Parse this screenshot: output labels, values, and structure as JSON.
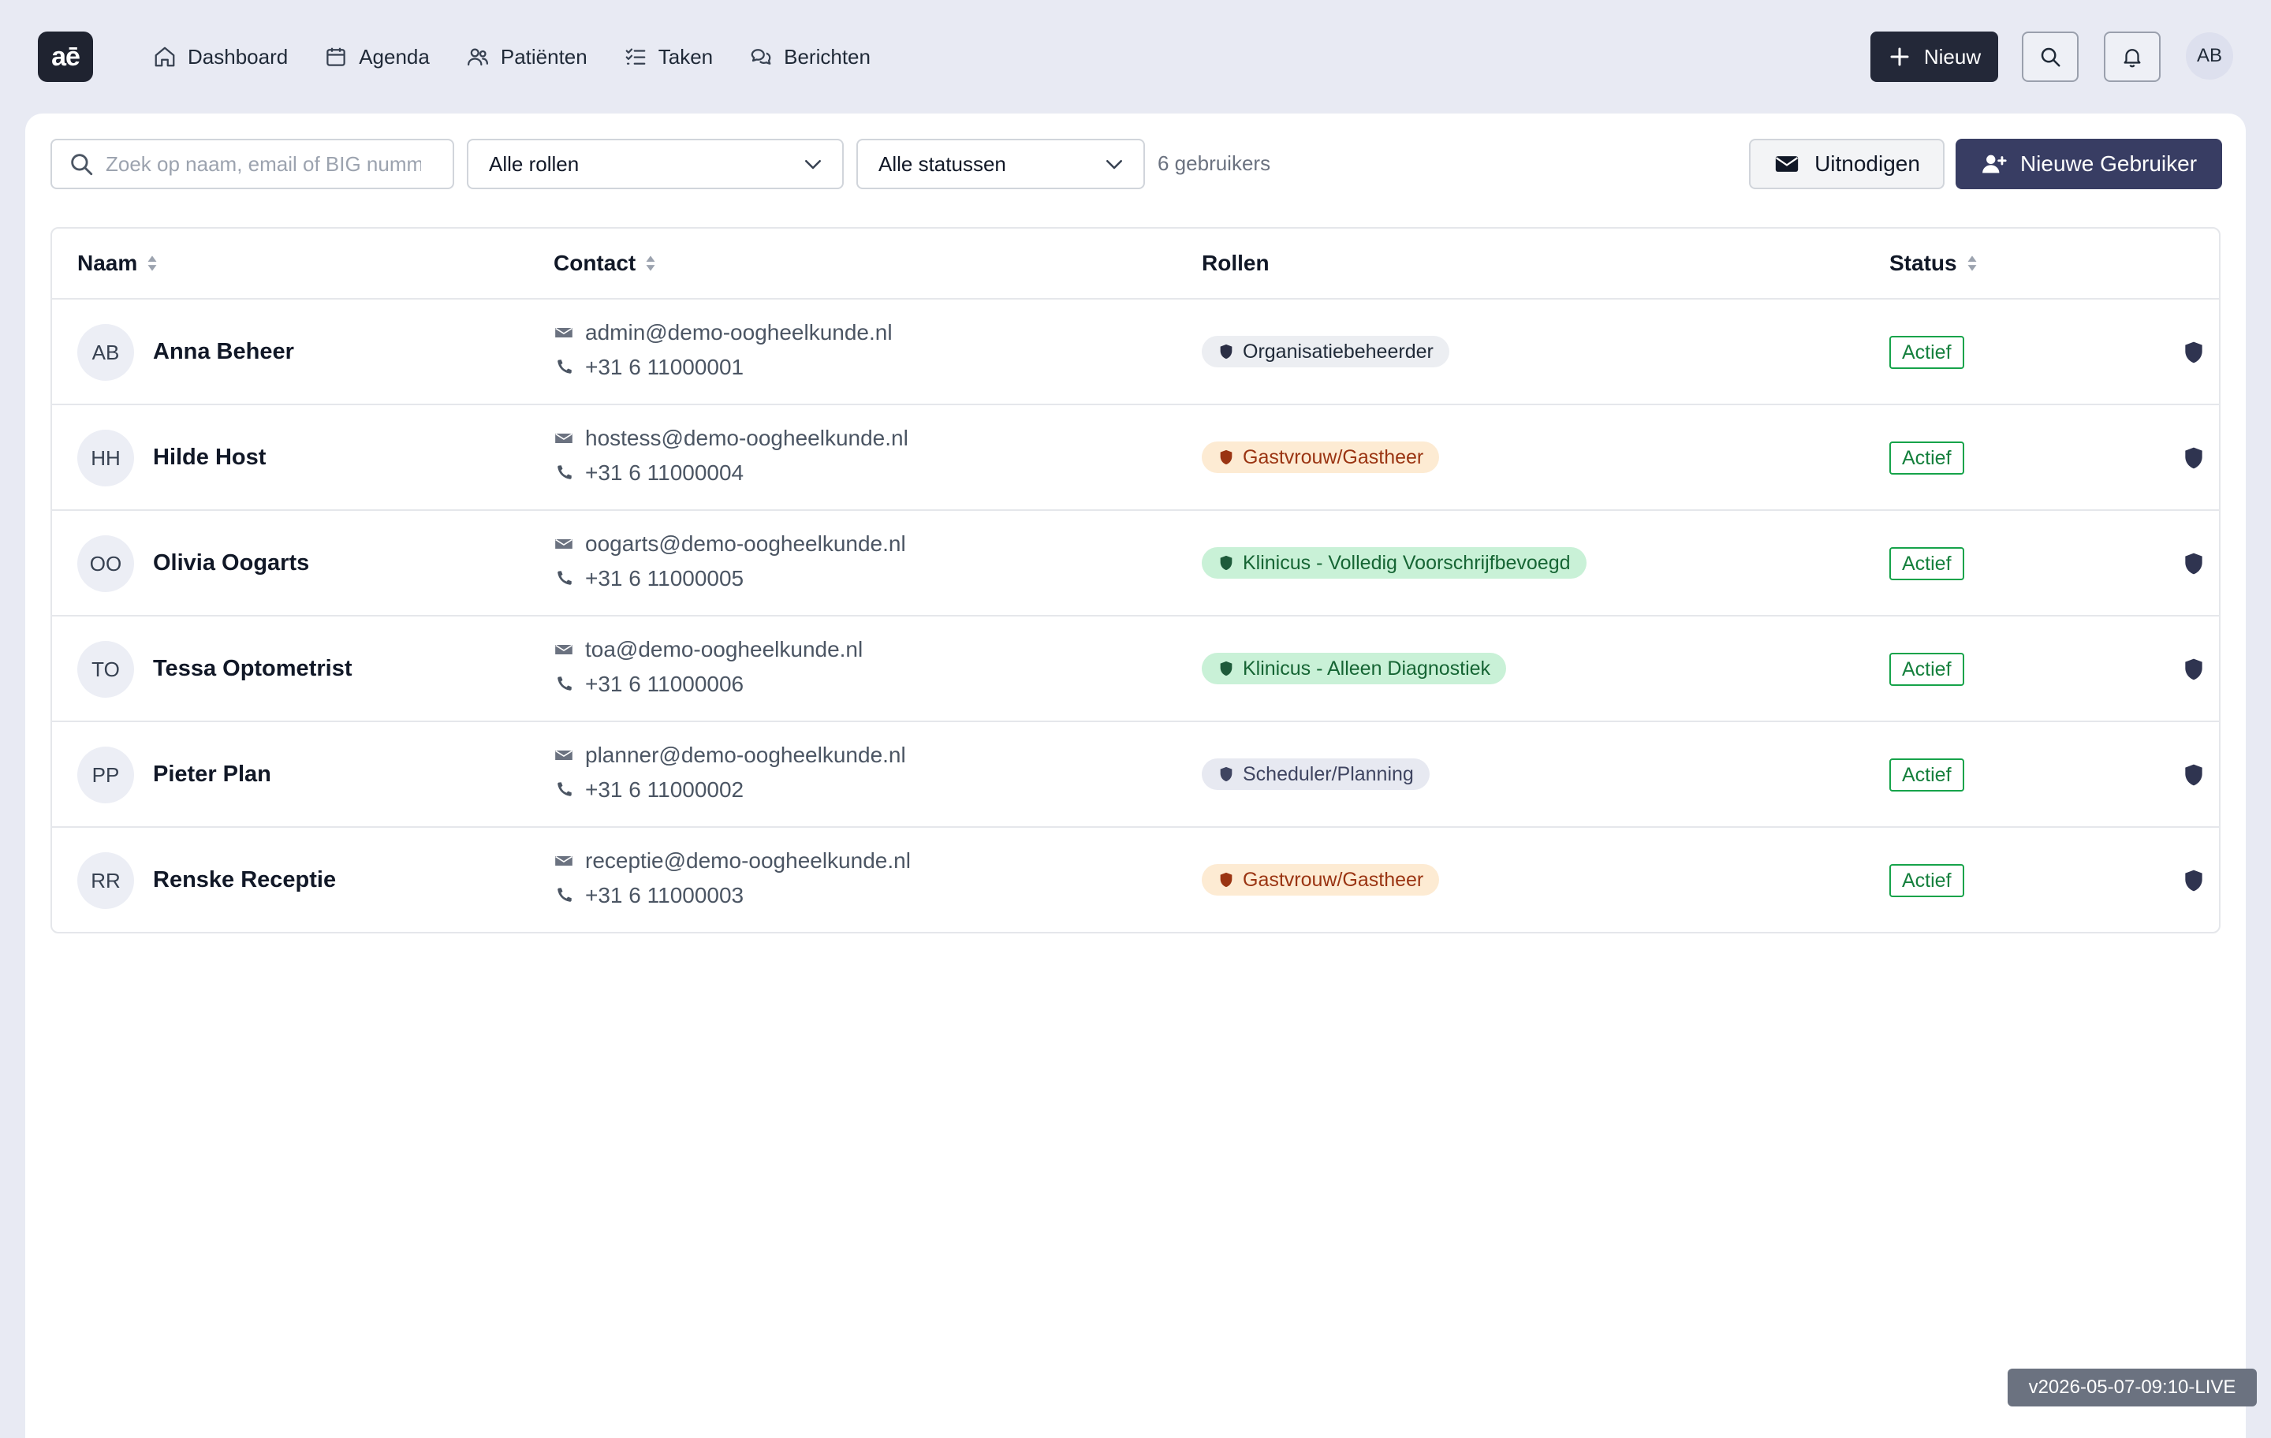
{
  "app": {
    "logo_text": "aē"
  },
  "nav": [
    {
      "label": "Dashboard",
      "icon": "home-icon"
    },
    {
      "label": "Agenda",
      "icon": "calendar-icon"
    },
    {
      "label": "Patiënten",
      "icon": "users-icon"
    },
    {
      "label": "Taken",
      "icon": "checklist-icon"
    },
    {
      "label": "Berichten",
      "icon": "messages-icon"
    }
  ],
  "header": {
    "new_label": "Nieuw",
    "avatar_initials": "AB"
  },
  "toolbar": {
    "search_placeholder": "Zoek op naam, email of BIG nummer",
    "role_filter": "Alle rollen",
    "status_filter": "Alle statussen",
    "user_count": "6 gebruikers",
    "invite_label": "Uitnodigen",
    "new_user_label": "Nieuwe Gebruiker"
  },
  "table": {
    "columns": {
      "name": "Naam",
      "contact": "Contact",
      "roles": "Rollen",
      "status": "Status"
    },
    "rows": [
      {
        "initials": "AB",
        "name": "Anna Beheer",
        "email": "admin@demo-oogheelkunde.nl",
        "phone": "+31 6 11000001",
        "role": "Organisatiebeheerder",
        "role_kind": "gray",
        "status": "Actief"
      },
      {
        "initials": "HH",
        "name": "Hilde Host",
        "email": "hostess@demo-oogheelkunde.nl",
        "phone": "+31 6 11000004",
        "role": "Gastvrouw/Gastheer",
        "role_kind": "orange",
        "status": "Actief"
      },
      {
        "initials": "OO",
        "name": "Olivia Oogarts",
        "email": "oogarts@demo-oogheelkunde.nl",
        "phone": "+31 6 11000005",
        "role": "Klinicus - Volledig Voorschrijfbevoegd",
        "role_kind": "green",
        "status": "Actief"
      },
      {
        "initials": "TO",
        "name": "Tessa Optometrist",
        "email": "toa@demo-oogheelkunde.nl",
        "phone": "+31 6 11000006",
        "role": "Klinicus - Alleen Diagnostiek",
        "role_kind": "green",
        "status": "Actief"
      },
      {
        "initials": "PP",
        "name": "Pieter Plan",
        "email": "planner@demo-oogheelkunde.nl",
        "phone": "+31 6 11000002",
        "role": "Scheduler/Planning",
        "role_kind": "slate",
        "status": "Actief"
      },
      {
        "initials": "RR",
        "name": "Renske Receptie",
        "email": "receptie@demo-oogheelkunde.nl",
        "phone": "+31 6 11000003",
        "role": "Gastvrouw/Gastheer",
        "role_kind": "orange",
        "status": "Actief"
      }
    ]
  },
  "colors": {
    "primary_dark": "#232838",
    "primary_indigo": "#383d63",
    "status_green": "#15803d",
    "role_gray_bg": "#eceef2",
    "role_gray_fg": "#1f2937",
    "role_gray_icon": "#2b2f45",
    "role_orange_bg": "#fdebd3",
    "role_orange_fg": "#9a3412",
    "role_orange_icon": "#9a3412",
    "role_green_bg": "#c9f1d7",
    "role_green_fg": "#166534",
    "role_green_icon": "#1e5a3a",
    "role_slate_bg": "#e7e9f1",
    "role_slate_fg": "#3f4561",
    "role_slate_icon": "#3f4561"
  },
  "footer": {
    "version": "v2026-05-07-09:10-LIVE"
  }
}
